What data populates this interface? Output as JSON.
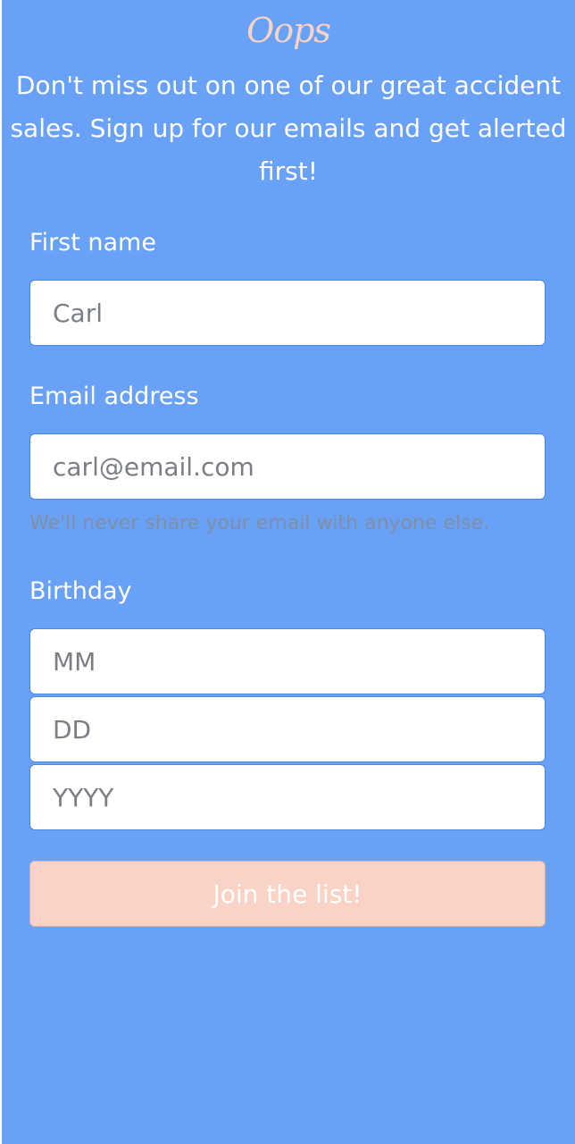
{
  "brand": {
    "logo_text": "Oops"
  },
  "intro": {
    "tagline": "Don't miss out on one of our great accident sales. Sign up for our emails and get alerted first!"
  },
  "form": {
    "first_name": {
      "label": "First name",
      "placeholder": "Carl"
    },
    "email": {
      "label": "Email address",
      "placeholder": "carl@email.com",
      "help": "We'll never share your email with anyone else."
    },
    "birthday": {
      "label": "Birthday",
      "month_placeholder": "MM",
      "day_placeholder": "DD",
      "year_placeholder": "YYYY"
    },
    "submit_label": "Join the list!"
  },
  "colors": {
    "background": "#69a1f6",
    "accent": "#f9d3c5",
    "text": "#ffffff",
    "help_text": "#7f8fa8"
  }
}
